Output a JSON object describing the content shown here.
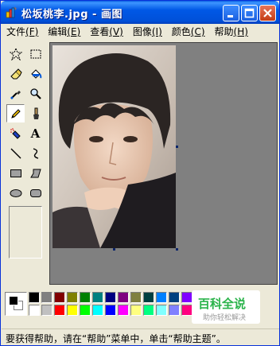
{
  "window": {
    "title": "松坂桃李.jpg - 画图"
  },
  "menu": {
    "items": [
      {
        "label": "文件",
        "accel": "(F)"
      },
      {
        "label": "编辑",
        "accel": "(E)"
      },
      {
        "label": "查看",
        "accel": "(V)"
      },
      {
        "label": "图像",
        "accel": "(I)"
      },
      {
        "label": "颜色",
        "accel": "(C)"
      },
      {
        "label": "帮助",
        "accel": "(H)"
      }
    ]
  },
  "tools": [
    {
      "name": "free-select",
      "icon": "star-select-icon"
    },
    {
      "name": "rect-select",
      "icon": "rect-select-icon"
    },
    {
      "name": "eraser",
      "icon": "eraser-icon"
    },
    {
      "name": "fill",
      "icon": "paint-bucket-icon"
    },
    {
      "name": "pick-color",
      "icon": "eyedropper-icon"
    },
    {
      "name": "magnifier",
      "icon": "magnifier-icon"
    },
    {
      "name": "pencil",
      "icon": "pencil-icon",
      "active": true
    },
    {
      "name": "brush",
      "icon": "brush-icon"
    },
    {
      "name": "airbrush",
      "icon": "airbrush-icon"
    },
    {
      "name": "text",
      "icon": "text-icon",
      "glyph": "A"
    },
    {
      "name": "line",
      "icon": "line-icon"
    },
    {
      "name": "curve",
      "icon": "curve-icon"
    },
    {
      "name": "rectangle",
      "icon": "rectangle-icon"
    },
    {
      "name": "polygon",
      "icon": "polygon-icon"
    },
    {
      "name": "ellipse",
      "icon": "ellipse-icon"
    },
    {
      "name": "rounded-rectangle",
      "icon": "rounded-rect-icon"
    }
  ],
  "palette": {
    "foreground": "#000000",
    "background": "#FFFFFF",
    "row1": [
      "#000000",
      "#808080",
      "#800000",
      "#808000",
      "#008000",
      "#008080",
      "#000080",
      "#800080",
      "#808040",
      "#004040",
      "#0080FF",
      "#004080",
      "#8000FF",
      "#804000"
    ],
    "row2": [
      "#FFFFFF",
      "#C0C0C0",
      "#FF0000",
      "#FFFF00",
      "#00FF00",
      "#00FFFF",
      "#0000FF",
      "#FF00FF",
      "#FFFF80",
      "#00FF80",
      "#80FFFF",
      "#8080FF",
      "#FF0080",
      "#FF8040"
    ]
  },
  "watermark": {
    "title": "百科全说",
    "subtitle": "助你轻松解决"
  },
  "status": {
    "text": "要获得帮助，请在“帮助”菜单中，单击“帮助主题”。"
  }
}
